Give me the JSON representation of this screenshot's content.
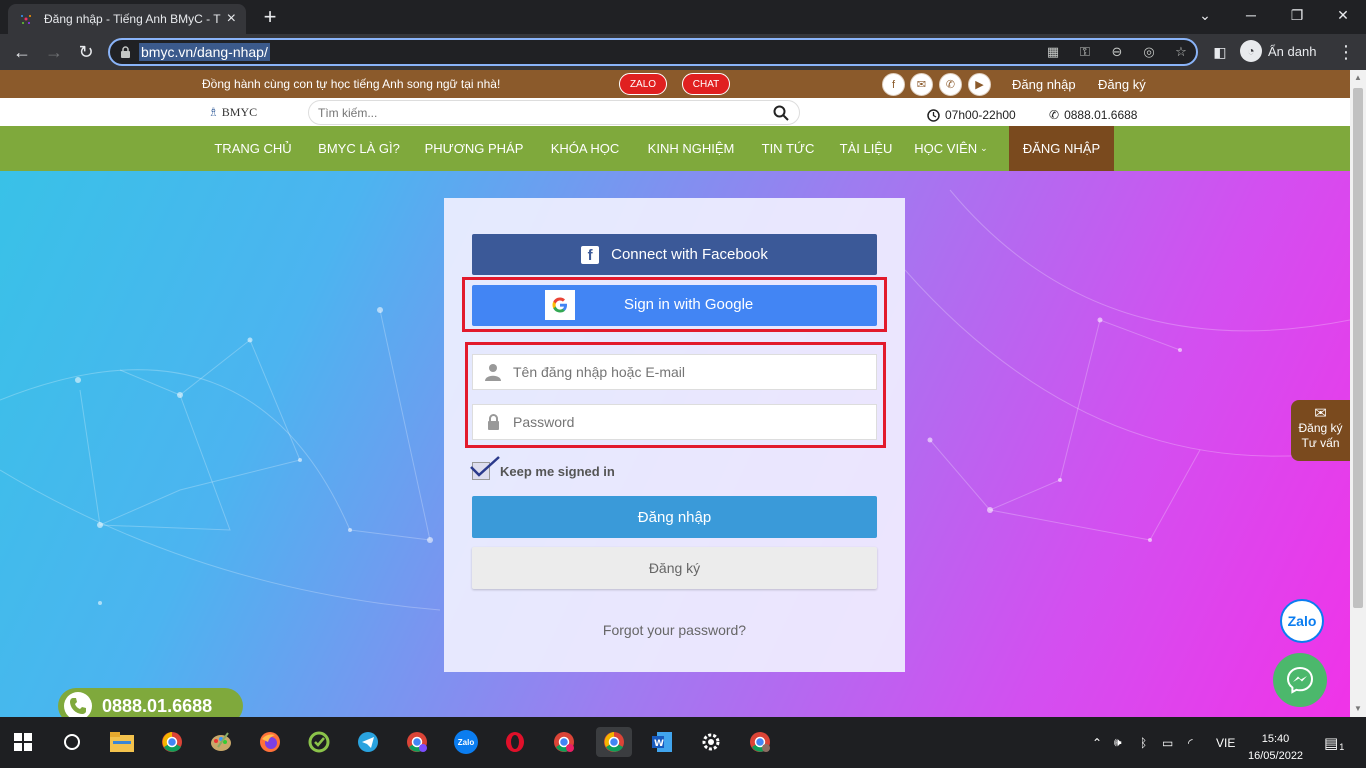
{
  "browser": {
    "tab_title": "Đăng nhập - Tiếng Anh BMyC - T",
    "url": "bmyc.vn/dang-nhap/",
    "profile_label": "Ẩn danh",
    "new_tab_label": "+",
    "close_tab_label": "×"
  },
  "topbar": {
    "slogan": "Đồng hành cùng con tự học tiếng Anh song ngữ tại nhà!",
    "zalo_label": "ZALO",
    "chat_label": "CHAT",
    "login_link": "Đăng nhập",
    "register_link": "Đăng ký"
  },
  "header": {
    "logo_text": "BMYC",
    "search_placeholder": "Tìm kiếm...",
    "hours": "07h00-22h00",
    "phone": "0888.01.6688"
  },
  "nav": {
    "items": [
      "TRANG CHỦ",
      "BMYC LÀ GÌ?",
      "PHƯƠNG PHÁP",
      "KHÓA HỌC",
      "KINH NGHIỆM",
      "TIN TỨC",
      "TÀI LIỆU",
      "HỌC VIÊN",
      "ĐĂNG NHẬP"
    ]
  },
  "login": {
    "facebook_label": "Connect with Facebook",
    "google_label": "Sign in with Google",
    "username_placeholder": "Tên đăng nhập hoặc E-mail",
    "password_placeholder": "Password",
    "keep_signed_in": "Keep me signed in",
    "submit_label": "Đăng nhập",
    "register_label": "Đăng ký",
    "forgot_label": "Forgot your password?"
  },
  "floating": {
    "side_tab_line1": "Đăng ký",
    "side_tab_line2": "Tư vấn",
    "zalo_label": "Zalo",
    "hotline": "0888.01.6688"
  },
  "taskbar": {
    "language": "VIE",
    "time": "15:40",
    "date": "16/05/2022",
    "notification_count": "1",
    "zalo_label": "Zalo"
  },
  "colors": {
    "brown": "#8b5a2b",
    "nav_green": "#7fa93c",
    "facebook": "#3b5998",
    "google": "#4285f4",
    "login_button": "#3a9ad9",
    "highlight_red": "#e21a2c"
  }
}
